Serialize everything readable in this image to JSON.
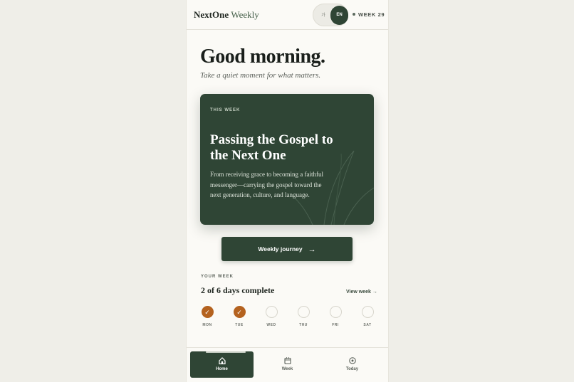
{
  "app": {
    "brand_main": "NextOne",
    "brand_accent": "Weekly"
  },
  "header": {
    "lang_options": [
      "가",
      "EN"
    ],
    "lang_selected": "EN",
    "week_badge": "WEEK 29"
  },
  "hero": {
    "greeting": "Good morning.",
    "subtitle": "Take a quiet moment for what matters."
  },
  "card": {
    "eyebrow": "THIS WEEK",
    "title": "Passing the Gospel to the Next One",
    "body": "From receiving grace to becoming a faithful messenger—carrying the gospel toward the next generation, culture, and language."
  },
  "cta": {
    "label": "Weekly journey",
    "icon": "arrow-right-icon"
  },
  "progress": {
    "section_label": "YOUR WEEK",
    "title": "2 of 6 days complete",
    "view_link": "View week →",
    "completed_days": 2,
    "total_days": 6,
    "days": [
      {
        "label": "MON",
        "done": true
      },
      {
        "label": "TUE",
        "done": true
      },
      {
        "label": "WED",
        "done": false
      },
      {
        "label": "THU",
        "done": false
      },
      {
        "label": "FRI",
        "done": false
      },
      {
        "label": "SAT",
        "done": false
      }
    ]
  },
  "tabs": [
    {
      "label": "Home",
      "icon": "home-icon",
      "active": true
    },
    {
      "label": "Week",
      "icon": "calendar-icon",
      "active": false
    },
    {
      "label": "Today",
      "icon": "target-icon",
      "active": false
    }
  ],
  "colors": {
    "primary": "#2f4535",
    "accent_done": "#b4621f",
    "background": "#fbfaf6"
  }
}
